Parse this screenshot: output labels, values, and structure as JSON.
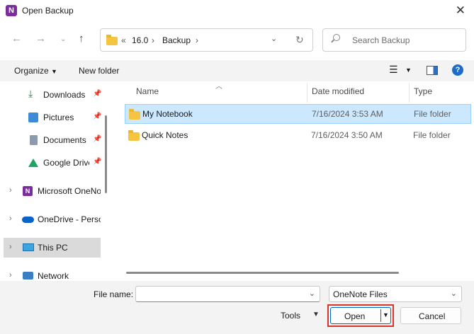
{
  "window": {
    "title": "Open Backup",
    "app_icon": "onenote-icon"
  },
  "nav": {
    "back_icon": "back-arrow-icon",
    "forward_icon": "forward-arrow-icon",
    "recent_icon": "chevron-down-icon",
    "up_icon": "up-arrow-icon",
    "breadcrumb": [
      "«",
      "16.0",
      "›",
      "Backup",
      "›"
    ],
    "refresh_icon": "refresh-icon",
    "search_placeholder": "Search Backup"
  },
  "toolbar": {
    "organize": "Organize",
    "new_folder": "New folder",
    "view_icon": "list-view-icon",
    "preview_icon": "preview-pane-icon",
    "help_icon": "help-icon"
  },
  "sidebar": {
    "items": [
      {
        "label": "Downloads",
        "icon": "download-icon",
        "pinned": true
      },
      {
        "label": "Pictures",
        "icon": "pictures-icon",
        "pinned": true
      },
      {
        "label": "Documents",
        "icon": "documents-icon",
        "pinned": true
      },
      {
        "label": "Google Drive",
        "icon": "google-drive-icon",
        "pinned": true
      },
      {
        "label": "Microsoft OneNote",
        "icon": "onenote-icon",
        "expandable": true
      },
      {
        "label": "OneDrive - Personal",
        "icon": "onedrive-icon",
        "expandable": true
      },
      {
        "label": "This PC",
        "icon": "this-pc-icon",
        "expandable": true,
        "selected": true
      },
      {
        "label": "Network",
        "icon": "network-icon",
        "expandable": true
      }
    ]
  },
  "columns": {
    "name": "Name",
    "date": "Date modified",
    "type": "Type"
  },
  "files": [
    {
      "name": "My Notebook",
      "date": "7/16/2024 3:53 AM",
      "type": "File folder",
      "selected": true
    },
    {
      "name": "Quick Notes",
      "date": "7/16/2024 3:50 AM",
      "type": "File folder",
      "selected": false
    }
  ],
  "footer": {
    "file_name_label": "File name:",
    "file_name_value": "",
    "file_type": "OneNote Files",
    "tools": "Tools",
    "open": "Open",
    "cancel": "Cancel"
  },
  "colors": {
    "accent": "#0067c0",
    "selection": "#cce8ff",
    "highlight": "#d9352d",
    "folder": "#f5c542"
  }
}
